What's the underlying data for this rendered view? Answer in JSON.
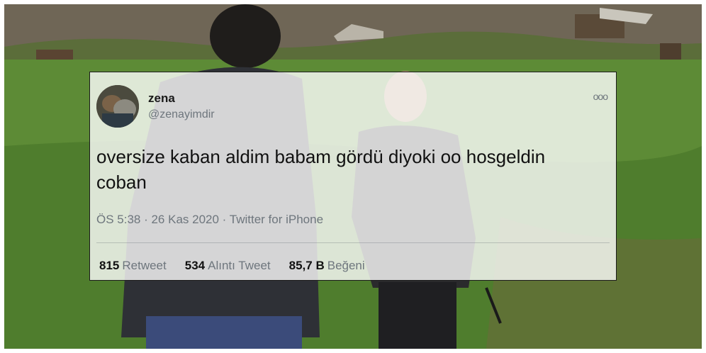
{
  "tweet": {
    "name": "zena",
    "handle": "@zenayimdir",
    "more": "ooo",
    "text_line1": "oversize kaban aldim babam gördü diyoki oo hosgeldin",
    "text_line2": "coban",
    "timestamp": "ÖS 5:38 · 26 Kas 2020 · Twitter for iPhone",
    "stats": [
      {
        "count": "815",
        "label": "Retweet"
      },
      {
        "count": "534",
        "label": "Alıntı Tweet"
      },
      {
        "count": "85,7 B",
        "label": "Beğeni"
      }
    ]
  }
}
